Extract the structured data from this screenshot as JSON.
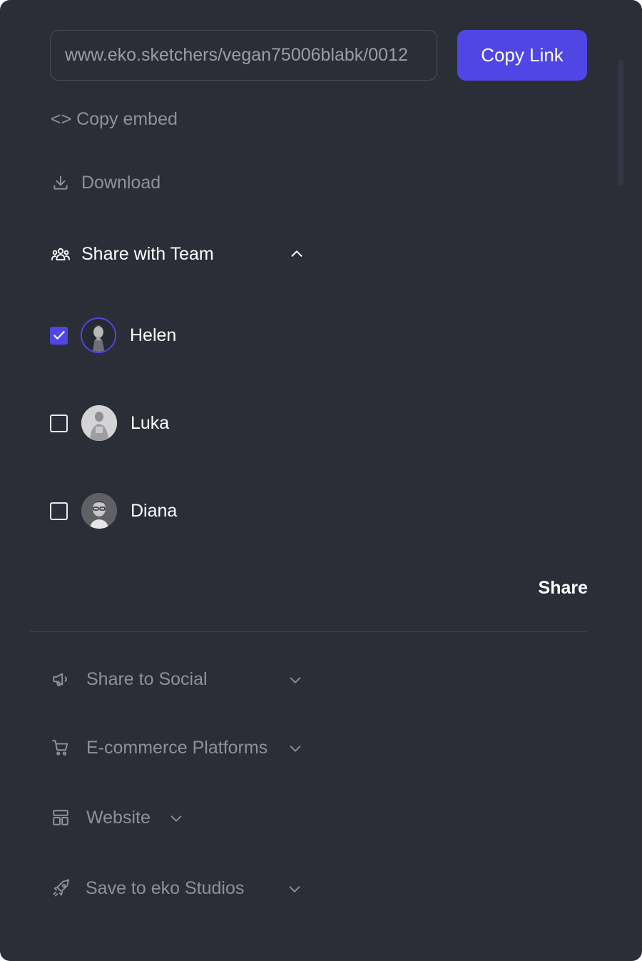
{
  "share": {
    "url_value": "www.eko.sketchers/vegan75006blabk/0012",
    "copy_link_label": "Copy Link",
    "copy_embed_label": "<> Copy embed",
    "download_label": "Download",
    "team_section_label": "Share with Team",
    "team_members": [
      {
        "name": "Helen",
        "checked": true
      },
      {
        "name": "Luka",
        "checked": false
      },
      {
        "name": "Diana",
        "checked": false
      }
    ],
    "share_button_label": "Share",
    "sections": [
      {
        "label": "Share to Social",
        "icon": "megaphone-icon"
      },
      {
        "label": "E-commerce Platforms",
        "icon": "cart-icon"
      },
      {
        "label": "Website",
        "icon": "layout-icon"
      },
      {
        "label": "Save to eko Studios",
        "icon": "rocket-icon"
      }
    ]
  },
  "colors": {
    "panel_bg": "#2c2e37",
    "accent": "#4f46e5",
    "muted_text": "#8e919b"
  }
}
